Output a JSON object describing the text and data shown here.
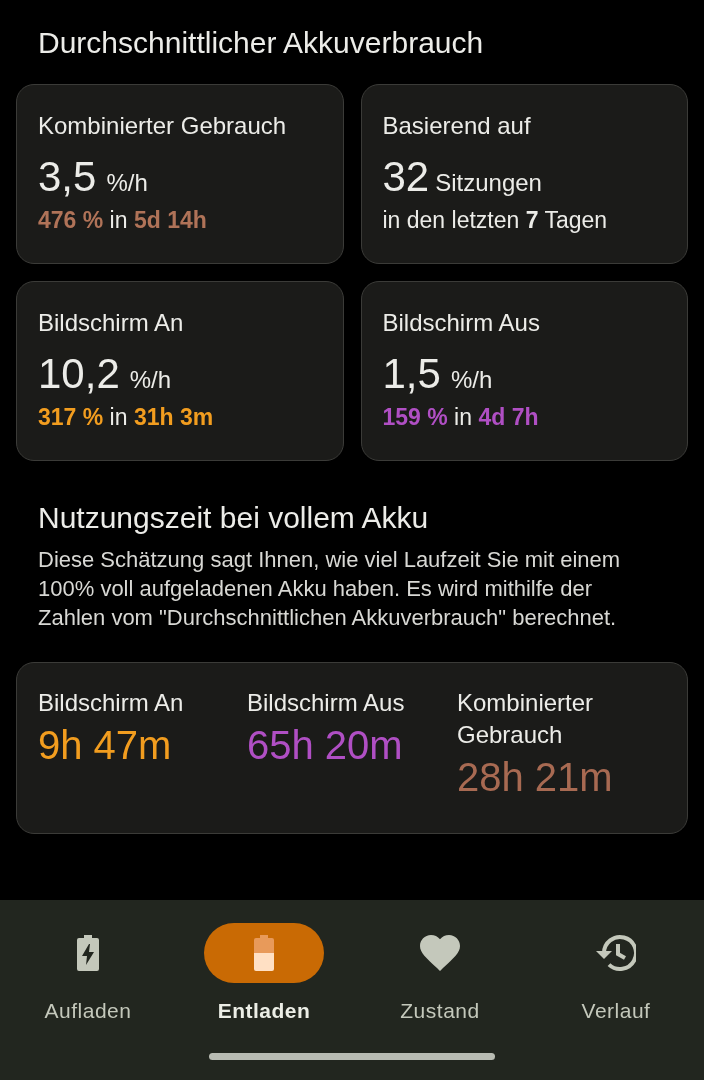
{
  "heading": "Durchschnittlicher Akkuverbrauch",
  "cards": [
    {
      "kind": "rate",
      "title": "Kombinierter Gebrauch",
      "value": "3,5",
      "unit": "%/h",
      "detail": "**476 %** in **5d 14h**",
      "color": "#b07358"
    },
    {
      "kind": "sessions",
      "title": "Basierend auf",
      "value": "32",
      "unit": "Sitzungen",
      "detail": "in den letzten **7** Tagen"
    },
    {
      "kind": "rate",
      "title": "Bildschirm An",
      "value": "10,2",
      "unit": "%/h",
      "detail": "**317 %** in **31h 3m**",
      "color": "#f29d1f"
    },
    {
      "kind": "rate",
      "title": "Bildschirm Aus",
      "value": "1,5",
      "unit": "%/h",
      "detail": "**159 %** in **4d 7h**",
      "color": "#b04fc4"
    }
  ],
  "estimate": {
    "heading": "Nutzungszeit bei vollem Akku",
    "description": "Diese Schätzung sagt Ihnen, wie viel Laufzeit Sie mit einem 100% voll aufgeladenen Akku haben. Es wird mithilfe der Zahlen vom \"Durchschnittlichen Akkuverbrauch\" berechnet.",
    "items": [
      {
        "label": "Bildschirm An",
        "value": "9h 47m",
        "color": "#f29d1f"
      },
      {
        "label": "Bildschirm Aus",
        "value": "65h 20m",
        "color": "#b04fc4"
      },
      {
        "label": "Kombinierter Gebrauch",
        "value": "28h 21m",
        "color": "#a86a52"
      }
    ]
  },
  "nav": [
    {
      "kind": "charging",
      "label": "Aufladen",
      "selected": false
    },
    {
      "kind": "battery",
      "label": "Entladen",
      "selected": true
    },
    {
      "kind": "heart",
      "label": "Zustand",
      "selected": false
    },
    {
      "kind": "history",
      "label": "Verlauf",
      "selected": false
    }
  ]
}
